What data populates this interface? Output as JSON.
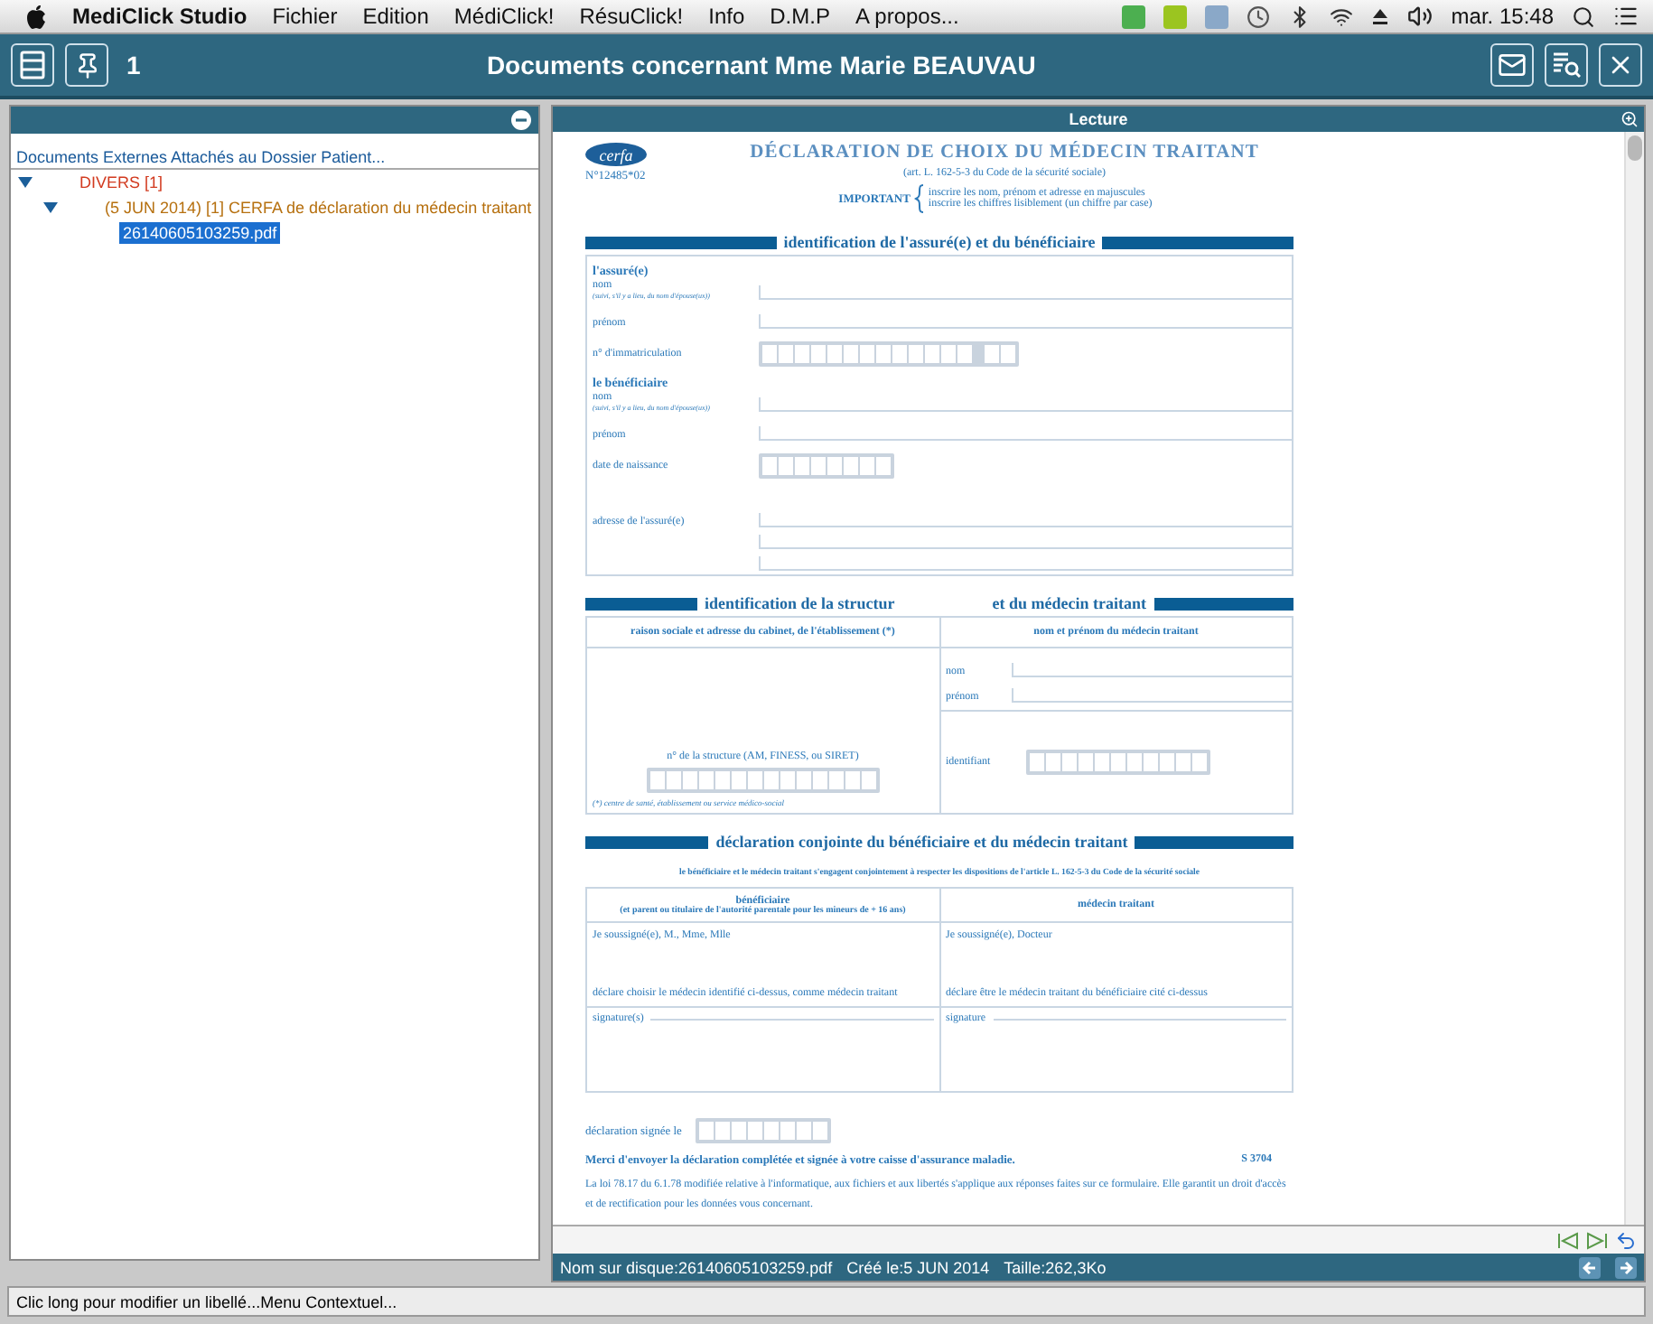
{
  "menu_bar": {
    "app": "MediClick Studio",
    "items": [
      "Fichier",
      "Edition",
      "MédiClick!",
      "RésuClick!",
      "Info",
      "D.M.P",
      "A propos..."
    ],
    "clock": "mar. 15:48"
  },
  "window": {
    "title": "Documents concernant Mme Marie BEAUVAU",
    "count": "1"
  },
  "left_panel": {
    "heading": "Documents Externes Attachés au Dossier Patient...",
    "tree": [
      {
        "label": "DIVERS [1]",
        "expanded": true,
        "children": [
          {
            "label": "(5 JUN 2014) [1] CERFA de déclaration du médecin traitant",
            "expanded": true,
            "children": [
              {
                "label": "26140605103259.pdf",
                "selected": true
              }
            ]
          }
        ]
      }
    ]
  },
  "viewer": {
    "title": "Lecture",
    "document": {
      "logo": "cerfa",
      "number": "N°12485*02",
      "title": "DÉCLARATION DE CHOIX DU MÉDECIN TRAITANT",
      "subtitle": "(art. L. 162-5-3 du Code de la sécurité sociale)",
      "important": {
        "label": "IMPORTANT",
        "lines": [
          "inscrire les nom, prénom et adresse en majuscules",
          "inscrire les chiffres lisiblement (un chiffre par case)"
        ]
      },
      "section1": {
        "heading": "identification de l'assuré(e) et du bénéficiaire",
        "fields": [
          {
            "kind": "heading",
            "label": "l'assuré(e)"
          },
          {
            "kind": "line",
            "label": "nom",
            "note": "(suivi, s'il y a lieu, du nom d'épouse(ux))"
          },
          {
            "kind": "line",
            "label": "prénom"
          },
          {
            "kind": "nir_boxes",
            "label": "n° d'immatriculation"
          },
          {
            "kind": "heading",
            "label": "le bénéficiaire"
          },
          {
            "kind": "line",
            "label": "nom",
            "note": "(suivi, s'il y a lieu, du nom d'épouse(ux))"
          },
          {
            "kind": "line",
            "label": "prénom"
          },
          {
            "kind": "date_boxes",
            "label": "date de naissance"
          },
          {
            "kind": "address",
            "label": "adresse de l'assuré(e)"
          }
        ]
      },
      "section2": {
        "heading": [
          "identification de la structur",
          "et du médecin traitant"
        ],
        "left": {
          "header": "raison sociale et adresse du cabinet,  de l'établissement  (*)",
          "number_label": "n° de la structure (AM, FINESS, ou SIRET)",
          "footnote": "(*)  centre de santé,  établissement ou service médico-social"
        },
        "right": {
          "header": "nom et prénom du médecin traitant",
          "fields": [
            {
              "label": "nom"
            },
            {
              "label": "prénom"
            }
          ],
          "id_label": "identifiant"
        }
      },
      "section3": {
        "heading": "déclaration conjointe du bénéficiaire et du médecin traitant",
        "subheading": "le bénéficiaire et le médecin traitant s'engagent conjointement à respecter les dispositions de l'article L. 162-5-3 du Code de la sécurité sociale",
        "columns": [
          {
            "title": "bénéficiaire",
            "subtitle": "(et parent ou titulaire de l'autorité parentale pour les mineurs de + 16 ans)",
            "lines": [
              "Je soussigné(e), M., Mme, Mlle",
              "déclare choisir le médecin identifié ci-dessus, comme médecin traitant"
            ],
            "signature": "signature(s)"
          },
          {
            "title": "médecin traitant",
            "lines": [
              "Je soussigné(e), Docteur",
              "déclare être le médecin traitant du bénéficiaire cité ci-dessus"
            ],
            "signature": "signature"
          }
        ]
      },
      "footer": {
        "signed_label": "déclaration signée le",
        "thanks": "Merci d'envoyer la déclaration complétée et signée à votre caisse d'assurance maladie.",
        "code": "S 3704",
        "legal": "La loi 78.17 du 6.1.78 modifiée relative à l'informatique, aux fichiers et aux libertés s'applique aux réponses faites sur ce formulaire. Elle garantit un droit d'accès et de rectification pour les données vous concernant."
      }
    },
    "info": {
      "file": "Nom sur disque:26140605103259.pdf",
      "created": "Créé le:5 JUN 2014",
      "size": "Taille:262,3Ko"
    }
  },
  "status_bar": "Clic long pour modifier un libellé...Menu Contextuel..."
}
